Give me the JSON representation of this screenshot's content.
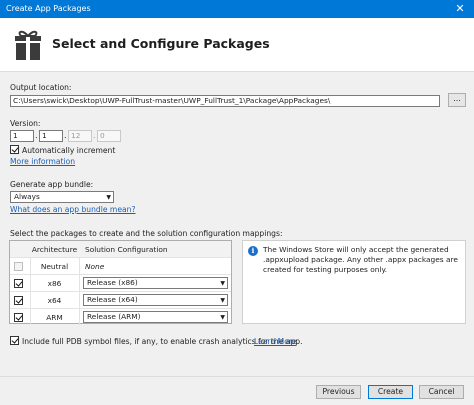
{
  "window": {
    "title": "Create App Packages",
    "close_glyph": "✕"
  },
  "header": {
    "title": "Select and Configure Packages",
    "icon": "package-gift-icon"
  },
  "output": {
    "label": "Output location:",
    "path": "C:\\Users\\swick\\Desktop\\UWP-FullTrust-master\\UWP_FullTrust_1\\Package\\AppPackages\\",
    "browse_label": "..."
  },
  "version": {
    "label": "Version:",
    "major": "1",
    "minor": "1",
    "build": "12",
    "revision": "0",
    "auto_increment_label": "Automatically increment",
    "auto_increment_checked": true,
    "more_info": "More information"
  },
  "bundle": {
    "label": "Generate app bundle:",
    "selected": "Always",
    "help_link": "What does an app bundle mean?"
  },
  "packages": {
    "instruction": "Select the packages to create and the solution configuration mappings:",
    "headers": {
      "architecture": "Architecture",
      "config": "Solution Configuration"
    },
    "rows": [
      {
        "arch": "Neutral",
        "config": "None",
        "checked": false,
        "enabled": false
      },
      {
        "arch": "x86",
        "config": "Release (x86)",
        "checked": true,
        "enabled": true
      },
      {
        "arch": "x64",
        "config": "Release (x64)",
        "checked": true,
        "enabled": true
      },
      {
        "arch": "ARM",
        "config": "Release (ARM)",
        "checked": true,
        "enabled": true
      }
    ]
  },
  "info": {
    "icon": "info-icon",
    "message": "The Windows Store will only accept the generated .appxupload package. Any other .appx packages are created for testing purposes only."
  },
  "pdb": {
    "label": "Include full PDB symbol files, if any, to enable crash analytics for the app.",
    "learn_more": "Learn More",
    "checked": true
  },
  "buttons": {
    "previous": "Previous",
    "create": "Create",
    "cancel": "Cancel"
  }
}
